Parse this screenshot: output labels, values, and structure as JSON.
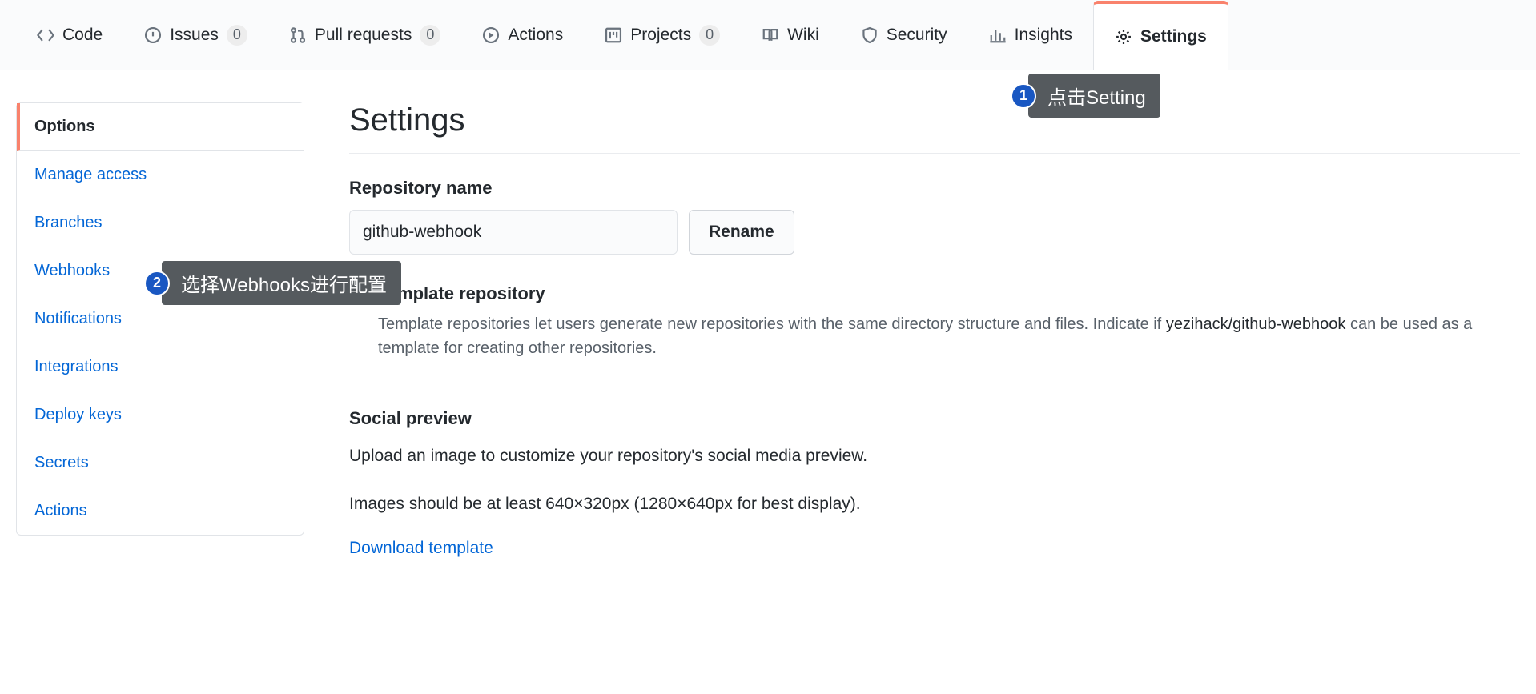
{
  "tabs": {
    "code": "Code",
    "issues": "Issues",
    "issues_count": "0",
    "pull_requests": "Pull requests",
    "pull_requests_count": "0",
    "actions": "Actions",
    "projects": "Projects",
    "projects_count": "0",
    "wiki": "Wiki",
    "security": "Security",
    "insights": "Insights",
    "settings": "Settings"
  },
  "sidebar": {
    "options": "Options",
    "manage_access": "Manage access",
    "branches": "Branches",
    "webhooks": "Webhooks",
    "notifications": "Notifications",
    "integrations": "Integrations",
    "deploy_keys": "Deploy keys",
    "secrets": "Secrets",
    "actions": "Actions"
  },
  "main": {
    "title": "Settings",
    "repo_name_label": "Repository name",
    "repo_name_value": "github-webhook",
    "rename_btn": "Rename",
    "template_checkbox_label": "Template repository",
    "template_help_1": "Template repositories let users generate new repositories with the same directory structure and files. Indicate if ",
    "template_help_bold": "yezihack/github-webhook",
    "template_help_2": " can be used as a template for creating other repositories.",
    "social_preview_title": "Social preview",
    "social_preview_desc1": "Upload an image to customize your repository's social media preview.",
    "social_preview_desc2": "Images should be at least 640×320px (1280×640px for best display).",
    "download_template": "Download template"
  },
  "callouts": {
    "c1_num": "1",
    "c1_text": "点击Setting",
    "c2_num": "2",
    "c2_text": "选择Webhooks进行配置"
  }
}
